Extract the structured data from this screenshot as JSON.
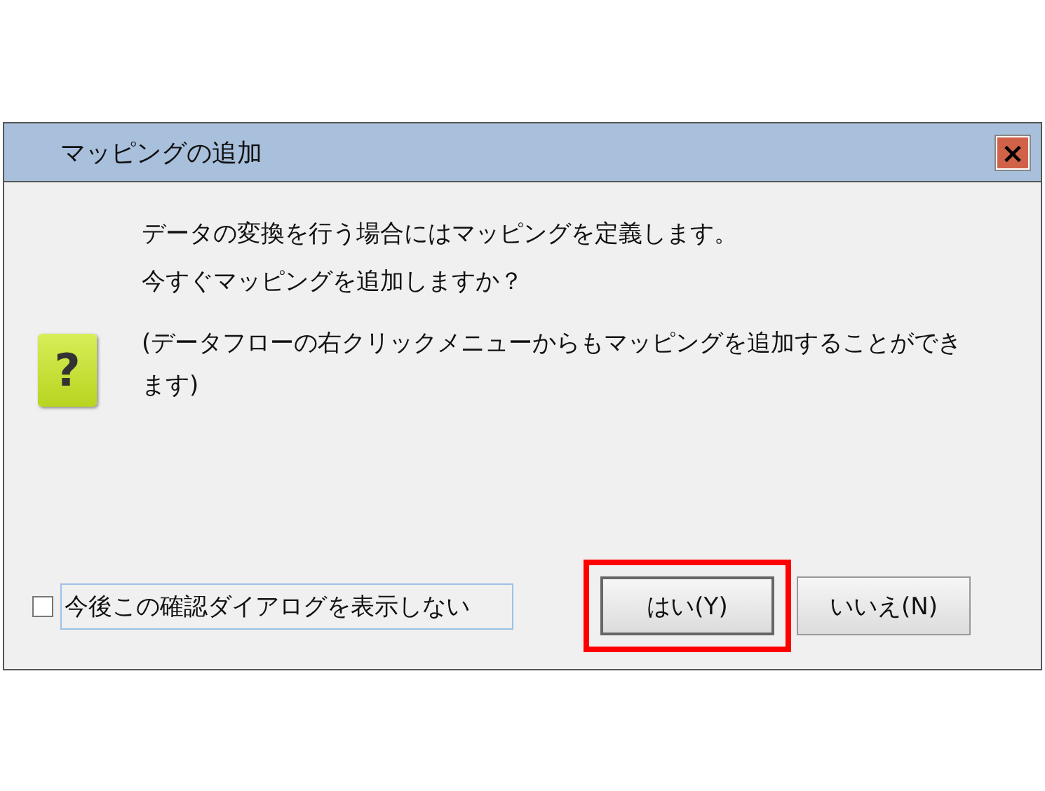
{
  "window": {
    "title": "マッピングの追加",
    "close_button": "×"
  },
  "message": [
    "データの変換を行う場合にはマッピングを定義します。",
    "今すぐマッピングを追加しますか？"
  ],
  "icon_glyph": "?",
  "note": "(データフローの右クリックメニューからもマッピングを追加することができます)",
  "dont_show_again": {
    "label": "今後この確認ダイアログを表示しない",
    "checked": false,
    "focused": true
  },
  "buttons": [
    {
      "label": "はい(Y)",
      "default": true,
      "highlighted": true
    },
    {
      "label": "いいえ(N)",
      "default": false,
      "highlighted": false
    }
  ]
}
